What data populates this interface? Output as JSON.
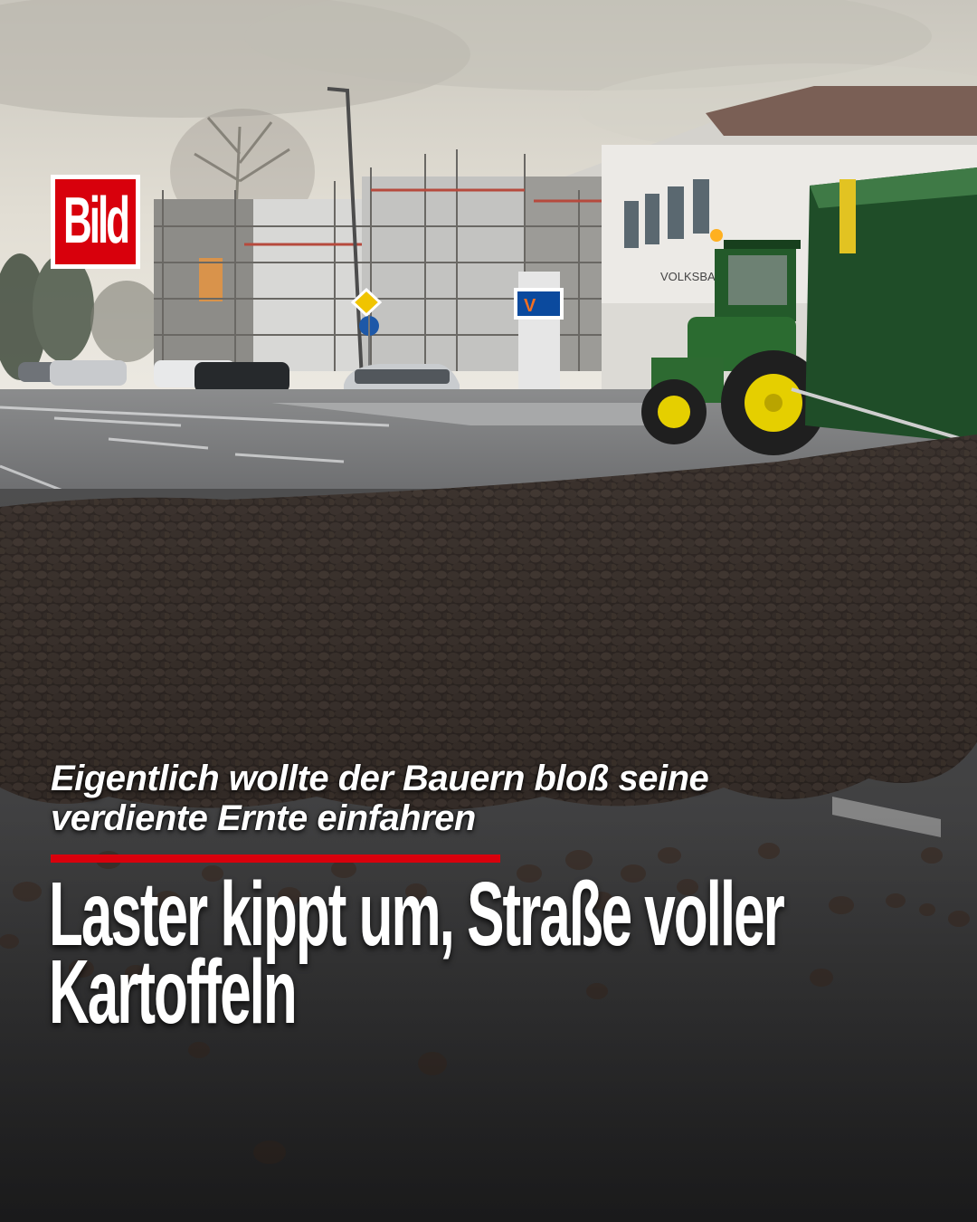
{
  "brand": {
    "logo_text": "Bild",
    "logo_color": "#d8000c"
  },
  "caption": {
    "kicker": "Eigentlich wollte der Bauern bloß seine verdiente Ernte einfahren",
    "headline": "Laster kippt um, Straße voller Kartoffeln"
  },
  "colors": {
    "accent_red": "#d8000c",
    "text": "#ffffff"
  },
  "photo": {
    "bank_sign_text": "VOLKSBANK"
  }
}
